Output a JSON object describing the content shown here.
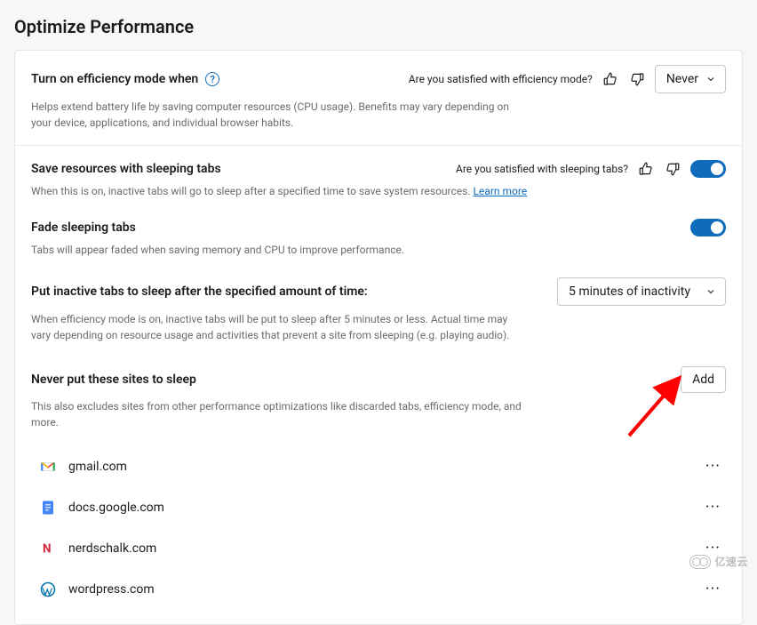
{
  "title": "Optimize Performance",
  "efficiency": {
    "heading": "Turn on efficiency mode when",
    "desc": "Helps extend battery life by saving computer resources (CPU usage). Benefits may vary depending on your device, applications, and individual browser habits.",
    "feedback_text": "Are you satisfied with efficiency mode?",
    "select_value": "Never"
  },
  "sleeping": {
    "heading": "Save resources with sleeping tabs",
    "desc_prefix": "When this is on, inactive tabs will go to sleep after a specified time to save system resources. ",
    "learn_more": "Learn more",
    "feedback_text": "Are you satisfied with sleeping tabs?",
    "fade_heading": "Fade sleeping tabs",
    "fade_desc": "Tabs will appear faded when saving memory and CPU to improve performance.",
    "inactive_heading": "Put inactive tabs to sleep after the specified amount of time:",
    "inactive_desc": "When efficiency mode is on, inactive tabs will be put to sleep after 5 minutes or less. Actual time may vary depending on resource usage and activities that prevent a site from sleeping (e.g. playing audio).",
    "inactive_select_value": "5 minutes of inactivity"
  },
  "never_sleep": {
    "heading": "Never put these sites to sleep",
    "desc": "This also excludes sites from other performance optimizations like discarded tabs, efficiency mode, and more.",
    "add_label": "Add",
    "sites": [
      {
        "domain": "gmail.com",
        "icon": "gmail"
      },
      {
        "domain": "docs.google.com",
        "icon": "gdocs"
      },
      {
        "domain": "nerdschalk.com",
        "icon": "nerds"
      },
      {
        "domain": "wordpress.com",
        "icon": "wordpress"
      }
    ]
  },
  "watermark": "亿速云"
}
